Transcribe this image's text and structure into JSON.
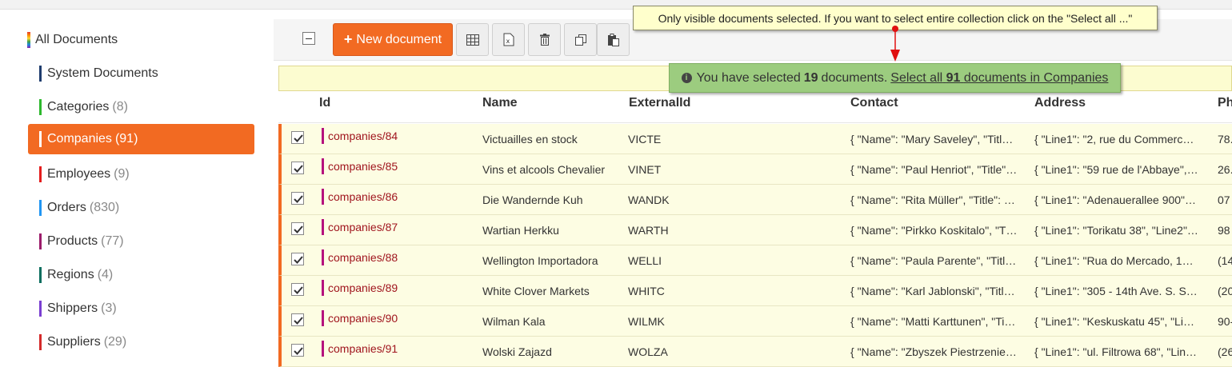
{
  "sidebar": {
    "all_label": "All Documents",
    "items": [
      {
        "label": "System Documents",
        "count": "",
        "color": "#1f3d6e"
      },
      {
        "label": "Categories",
        "count": "(8)",
        "color": "#2eb82e"
      },
      {
        "label": "Companies",
        "count": "(91)",
        "color": "#ffffff",
        "active": true
      },
      {
        "label": "Employees",
        "count": "(9)",
        "color": "#e41d1d"
      },
      {
        "label": "Orders",
        "count": "(830)",
        "color": "#2196f3"
      },
      {
        "label": "Products",
        "count": "(77)",
        "color": "#9c1c6b"
      },
      {
        "label": "Regions",
        "count": "(4)",
        "color": "#0b6e5f"
      },
      {
        "label": "Shippers",
        "count": "(3)",
        "color": "#7a3fd1"
      },
      {
        "label": "Suppliers",
        "count": "(29)",
        "color": "#d42a2a"
      }
    ]
  },
  "toolbar": {
    "new_document_label": "New document",
    "icons": [
      "table-icon",
      "excel-icon",
      "trash-icon",
      "copy-icon",
      "paste-icon"
    ]
  },
  "tooltip": {
    "text": "Only visible documents selected. If you want to select entire collection click on the \"Select all ...\""
  },
  "selection": {
    "prefix": "You have selected",
    "selected_count": "19",
    "suffix": "documents.",
    "link_prefix": "Select all",
    "total_count": "91",
    "link_suffix": "documents in Companies"
  },
  "table": {
    "columns": [
      "Id",
      "Name",
      "ExternalId",
      "Contact",
      "Address",
      "Ph"
    ],
    "rows": [
      {
        "id": "companies/84",
        "name": "Victuailles en stock",
        "external": "VICTE",
        "contact": "{ \"Name\": \"Mary Saveley\", \"Titl…",
        "address": "{ \"Line1\": \"2, rue du Commerc…",
        "phone": "78."
      },
      {
        "id": "companies/85",
        "name": "Vins et alcools Chevalier",
        "external": "VINET",
        "contact": "{ \"Name\": \"Paul Henriot\", \"Title\"…",
        "address": "{ \"Line1\": \"59 rue de l'Abbaye\",…",
        "phone": "26."
      },
      {
        "id": "companies/86",
        "name": "Die Wandernde Kuh",
        "external": "WANDK",
        "contact": "{ \"Name\": \"Rita Müller\", \"Title\": …",
        "address": "{ \"Line1\": \"Adenauerallee 900\"…",
        "phone": "07"
      },
      {
        "id": "companies/87",
        "name": "Wartian Herkku",
        "external": "WARTH",
        "contact": "{ \"Name\": \"Pirkko Koskitalo\", \"T…",
        "address": "{ \"Line1\": \"Torikatu 38\", \"Line2\"…",
        "phone": "98"
      },
      {
        "id": "companies/88",
        "name": "Wellington Importadora",
        "external": "WELLI",
        "contact": "{ \"Name\": \"Paula Parente\", \"Titl…",
        "address": "{ \"Line1\": \"Rua do Mercado, 1…",
        "phone": "(14"
      },
      {
        "id": "companies/89",
        "name": "White Clover Markets",
        "external": "WHITC",
        "contact": "{ \"Name\": \"Karl Jablonski\", \"Titl…",
        "address": "{ \"Line1\": \"305 - 14th Ave. S. S…",
        "phone": "(20"
      },
      {
        "id": "companies/90",
        "name": "Wilman Kala",
        "external": "WILMK",
        "contact": "{ \"Name\": \"Matti Karttunen\", \"Ti…",
        "address": "{ \"Line1\": \"Keskuskatu 45\", \"Li…",
        "phone": "90-"
      },
      {
        "id": "companies/91",
        "name": "Wolski Zajazd",
        "external": "WOLZA",
        "contact": "{ \"Name\": \"Zbyszek Piestrzenie…",
        "address": "{ \"Line1\": \"ul. Filtrowa 68\", \"Lin…",
        "phone": "(26"
      }
    ]
  }
}
